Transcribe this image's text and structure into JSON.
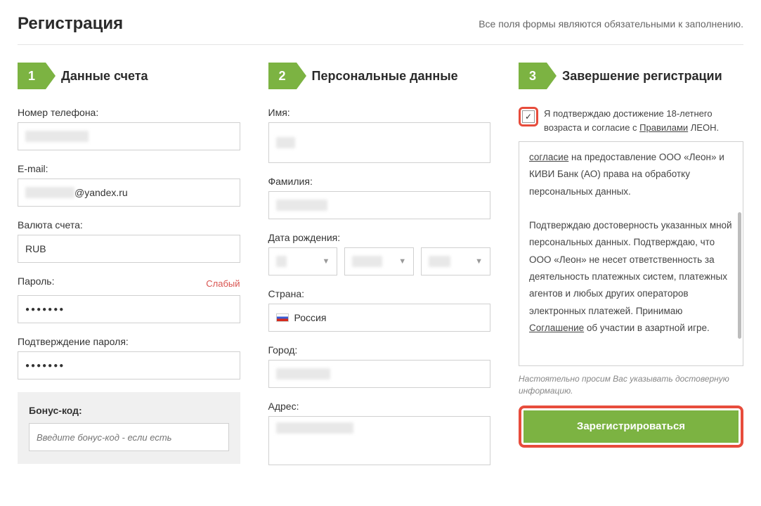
{
  "header": {
    "title": "Регистрация",
    "note": "Все поля формы являются обязательными к заполнению."
  },
  "step1": {
    "num": "1",
    "title": "Данные счета",
    "phone_label": "Номер телефона:",
    "email_label": "E-mail:",
    "email_suffix": "@yandex.ru",
    "currency_label": "Валюта счета:",
    "currency_value": "RUB",
    "password_label": "Пароль:",
    "password_strength": "Слабый",
    "confirm_label": "Подтверждение пароля:",
    "bonus_label": "Бонус-код:",
    "bonus_placeholder": "Введите бонус-код - если есть"
  },
  "step2": {
    "num": "2",
    "title": "Персональные данные",
    "name_label": "Имя:",
    "surname_label": "Фамилия:",
    "dob_label": "Дата рождения:",
    "country_label": "Страна:",
    "country_value": "Россия",
    "city_label": "Город:",
    "address_label": "Адрес:"
  },
  "step3": {
    "num": "3",
    "title": "Завершение регистрации",
    "checkbox_mark": "✓",
    "agree_before": "Я подтверждаю достижение 18-летнего возраста и согласие с ",
    "agree_link": "Правилами",
    "agree_after": " ЛЕОН.",
    "terms_preline": " на предоставление ООО «Леон» и КИВИ Банк (АО) права на обработку персональных данных.",
    "terms_link0": "согласие",
    "terms_para2": "Подтверждаю достоверность указанных мной персональных данных. Подтверждаю, что ООО «Леон» не несет ответственность за деятельность платежных систем, платежных агентов и любых других операторов электронных платежей. Принимаю ",
    "terms_link": "Соглашение",
    "terms_para2_after": " об участии в азартной игре.",
    "hint": "Настоятельно просим Вас указывать достоверную информацию.",
    "submit": "Зарегистрироваться"
  }
}
